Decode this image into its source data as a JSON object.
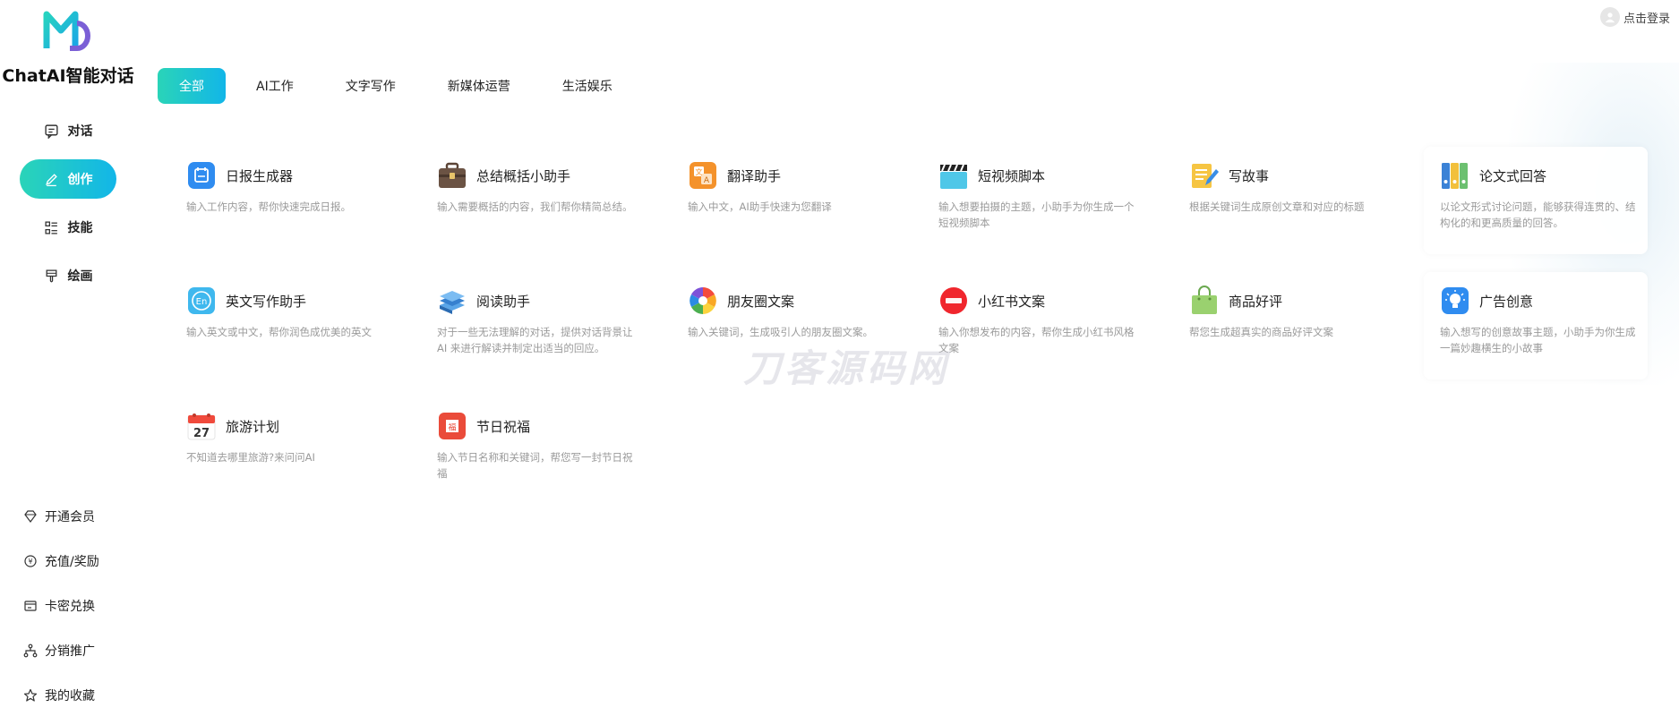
{
  "app": {
    "title": "ChatAI智能对话",
    "login_label": "点击登录"
  },
  "sidebar": {
    "nav": [
      {
        "label": "对话",
        "icon": "chat-icon"
      },
      {
        "label": "创作",
        "icon": "pen-icon",
        "active": true
      },
      {
        "label": "技能",
        "icon": "skill-icon"
      },
      {
        "label": "绘画",
        "icon": "brush-icon"
      }
    ],
    "bottom": [
      {
        "label": "开通会员",
        "icon": "diamond-icon"
      },
      {
        "label": "充值/奖励",
        "icon": "coin-icon"
      },
      {
        "label": "卡密兑换",
        "icon": "card-icon"
      },
      {
        "label": "分销推广",
        "icon": "share-icon"
      },
      {
        "label": "我的收藏",
        "icon": "star-icon"
      }
    ]
  },
  "tabs": [
    "全部",
    "AI工作",
    "文字写作",
    "新媒体运营",
    "生活娱乐"
  ],
  "cards": [
    {
      "title": "日报生成器",
      "desc": "输入工作内容，帮你快速完成日报。",
      "icon": "calendar-blue-icon"
    },
    {
      "title": "总结概括小助手",
      "desc": "输入需要概括的内容，我们帮你精简总结。",
      "icon": "briefcase-icon"
    },
    {
      "title": "翻译助手",
      "desc": "输入中文，AI助手快速为您翻译",
      "icon": "translate-icon"
    },
    {
      "title": "短视频脚本",
      "desc": "输入想要拍摄的主题，小助手为你生成一个短视频脚本",
      "icon": "clapperboard-icon"
    },
    {
      "title": "写故事",
      "desc": "根据关键词生成原创文章和对应的标题",
      "icon": "notepad-icon"
    },
    {
      "title": "论文式回答",
      "desc": "以论文形式讨论问题，能够获得连贯的、结构化的和更高质量的回答。",
      "icon": "binders-icon"
    },
    {
      "title": "英文写作助手",
      "desc": "输入英文或中文，帮你润色成优美的英文",
      "icon": "english-icon"
    },
    {
      "title": "阅读助手",
      "desc": "对于一些无法理解的对话，提供对话背景让 AI 来进行解读并制定出适当的回应。",
      "icon": "books-icon"
    },
    {
      "title": "朋友圈文案",
      "desc": "输入关键词，生成吸引人的朋友圈文案。",
      "icon": "aperture-icon"
    },
    {
      "title": "小红书文案",
      "desc": "输入你想发布的内容，帮你生成小红书风格文案",
      "icon": "xiaohongshu-icon"
    },
    {
      "title": "商品好评",
      "desc": "帮您生成超真实的商品好评文案",
      "icon": "shopping-bag-icon"
    },
    {
      "title": "广告创意",
      "desc": "输入想写的创意故事主题，小助手为你生成一篇妙趣横生的小故事",
      "icon": "lightbulb-icon"
    },
    {
      "title": "旅游计划",
      "desc": "不知道去哪里旅游?来问问AI",
      "icon": "calendar-27-icon",
      "icon_text": "27"
    },
    {
      "title": "节日祝福",
      "desc": "输入节日名称和关键词，帮您写一封节日祝福",
      "icon": "festival-icon",
      "icon_text": "福"
    }
  ],
  "watermark": "刀客源码网"
}
